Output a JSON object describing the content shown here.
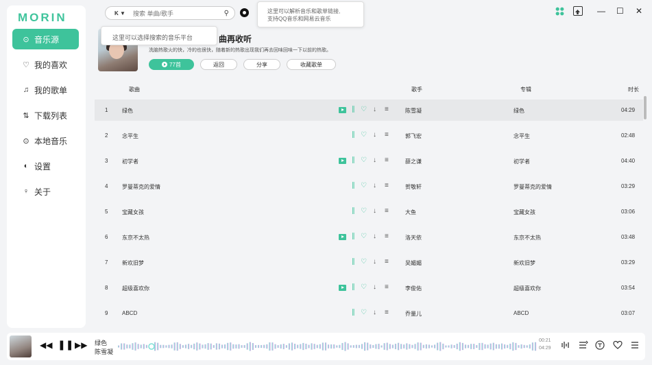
{
  "app": {
    "logo": "MORIN"
  },
  "colors": {
    "accent": "#3ec39b",
    "wave_start": "#7fe0d6",
    "wave_end": "#e6a8e8"
  },
  "sidebar": {
    "items": [
      {
        "label": "音乐源",
        "icon": "music-source-icon",
        "glyph": "⊙"
      },
      {
        "label": "我的喜欢",
        "icon": "heart-icon",
        "glyph": "♡"
      },
      {
        "label": "我的歌单",
        "icon": "playlist-icon",
        "glyph": "♫"
      },
      {
        "label": "下载列表",
        "icon": "download-list-icon",
        "glyph": "⇅"
      },
      {
        "label": "本地音乐",
        "icon": "local-music-icon",
        "glyph": "⊙"
      },
      {
        "label": "设置",
        "icon": "settings-icon",
        "glyph": "◐"
      },
      {
        "label": "关于",
        "icon": "about-icon",
        "glyph": "♀"
      }
    ]
  },
  "search": {
    "platform": "K ▼",
    "placeholder": "搜索 单曲/歌手"
  },
  "tooltips": {
    "parse_line1": "这里可以解析音乐和歌单链接,",
    "parse_line2": "支持QQ音乐和网易云音乐",
    "platform_tip": "这里可以选择搜索的音乐平台"
  },
  "window_controls": {
    "theme_icon": "theme-icon",
    "minimize": "—",
    "maximize": "☐",
    "close": "✕"
  },
  "playlist": {
    "title": "曲再收听",
    "description": "洗脑热歌火的快，冷的也很快，随着新的热歌出现我们再去回味回味一下以前的热歌。",
    "play_count": "77首",
    "back_label": "返回",
    "share_label": "分享",
    "collect_label": "收藏歌单"
  },
  "list": {
    "headers": {
      "song": "歌曲",
      "artist": "歌手",
      "album": "专辑",
      "duration": "时长"
    },
    "rows": [
      {
        "index": "1",
        "title": "绿色",
        "artist": "陈雪凝",
        "album": "绿色",
        "duration": "04:29",
        "mv": true
      },
      {
        "index": "2",
        "title": "念平生",
        "artist": "郭飞宏",
        "album": "念平生",
        "duration": "02:48",
        "mv": false
      },
      {
        "index": "3",
        "title": "初学者",
        "artist": "薛之谦",
        "album": "初学者",
        "duration": "04:40",
        "mv": true
      },
      {
        "index": "4",
        "title": "罗曼蒂克的爱情",
        "artist": "贺敬轩",
        "album": "罗曼蒂克的爱情",
        "duration": "03:29",
        "mv": false
      },
      {
        "index": "5",
        "title": "宝藏女孩",
        "artist": "大鱼",
        "album": "宝藏女孩",
        "duration": "03:06",
        "mv": false
      },
      {
        "index": "6",
        "title": "东京不太热",
        "artist": "洛天依",
        "album": "东京不太热",
        "duration": "03:48",
        "mv": true
      },
      {
        "index": "7",
        "title": "新欢旧梦",
        "artist": "吴媚媚",
        "album": "新欢旧梦",
        "duration": "03:29",
        "mv": false
      },
      {
        "index": "8",
        "title": "超级喜欢你",
        "artist": "李俊佑",
        "album": "超级喜欢你",
        "duration": "03:54",
        "mv": true
      },
      {
        "index": "9",
        "title": "ABCD",
        "artist": "乔量儿",
        "album": "ABCD",
        "duration": "03:07",
        "mv": false
      }
    ]
  },
  "player": {
    "title": "绿色",
    "artist": "陈雪凝",
    "current_time": "00:21",
    "total_time": "04:29",
    "progress": 0.08
  }
}
